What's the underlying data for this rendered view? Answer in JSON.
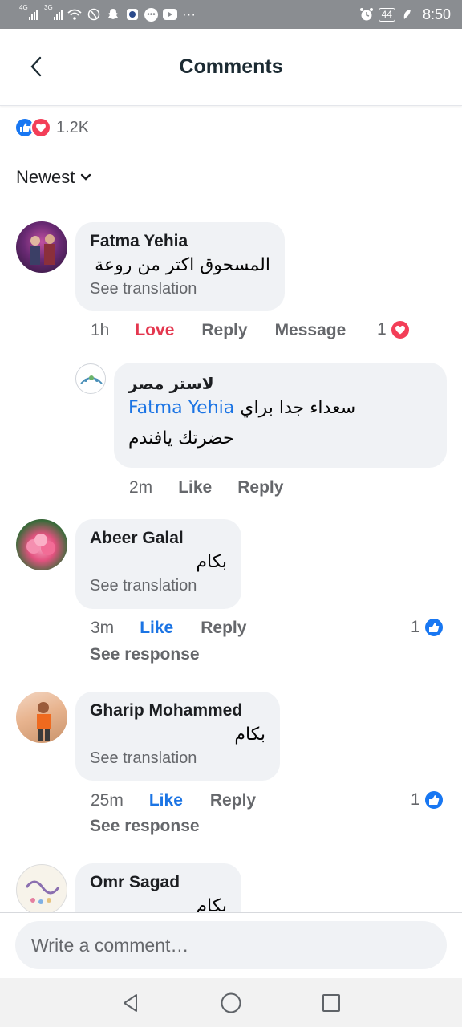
{
  "status_bar": {
    "net1": "4G",
    "net2": "3G",
    "battery": "44",
    "time": "8:50"
  },
  "header": {
    "title": "Comments"
  },
  "reactions": {
    "count": "1.2K"
  },
  "sort": {
    "label": "Newest"
  },
  "comments": [
    {
      "author": "Fatma Yehia",
      "text": "المسحوق اكتر من روعة",
      "see_translation": "See translation",
      "time": "1h",
      "reaction_label": "Love",
      "reply_label": "Reply",
      "message_label": "Message",
      "reaction_count": "1"
    },
    {
      "author": "Abeer Galal",
      "text": "بكام",
      "see_translation": "See translation",
      "time": "3m",
      "reaction_label": "Like",
      "reply_label": "Reply",
      "reaction_count": "1",
      "see_response": "See response"
    },
    {
      "author": "Gharip Mohammed",
      "text": "بكام",
      "see_translation": "See translation",
      "time": "25m",
      "reaction_label": "Like",
      "reply_label": "Reply",
      "reaction_count": "1",
      "see_response": "See response"
    },
    {
      "author": "Omr Sagad",
      "text": "بكام"
    }
  ],
  "reply": {
    "author": "لاستر مصر",
    "mention": "Fatma Yehia",
    "text_line1": "سعداء جدا براي",
    "text_line2": "حضرتك يافندم",
    "time": "2m",
    "like_label": "Like",
    "reply_label": "Reply"
  },
  "composer": {
    "placeholder": "Write a comment…"
  },
  "colors": {
    "accent": "#1877f2",
    "love": "#e4374f",
    "bubble": "#f0f2f5",
    "muted": "#65676b"
  }
}
